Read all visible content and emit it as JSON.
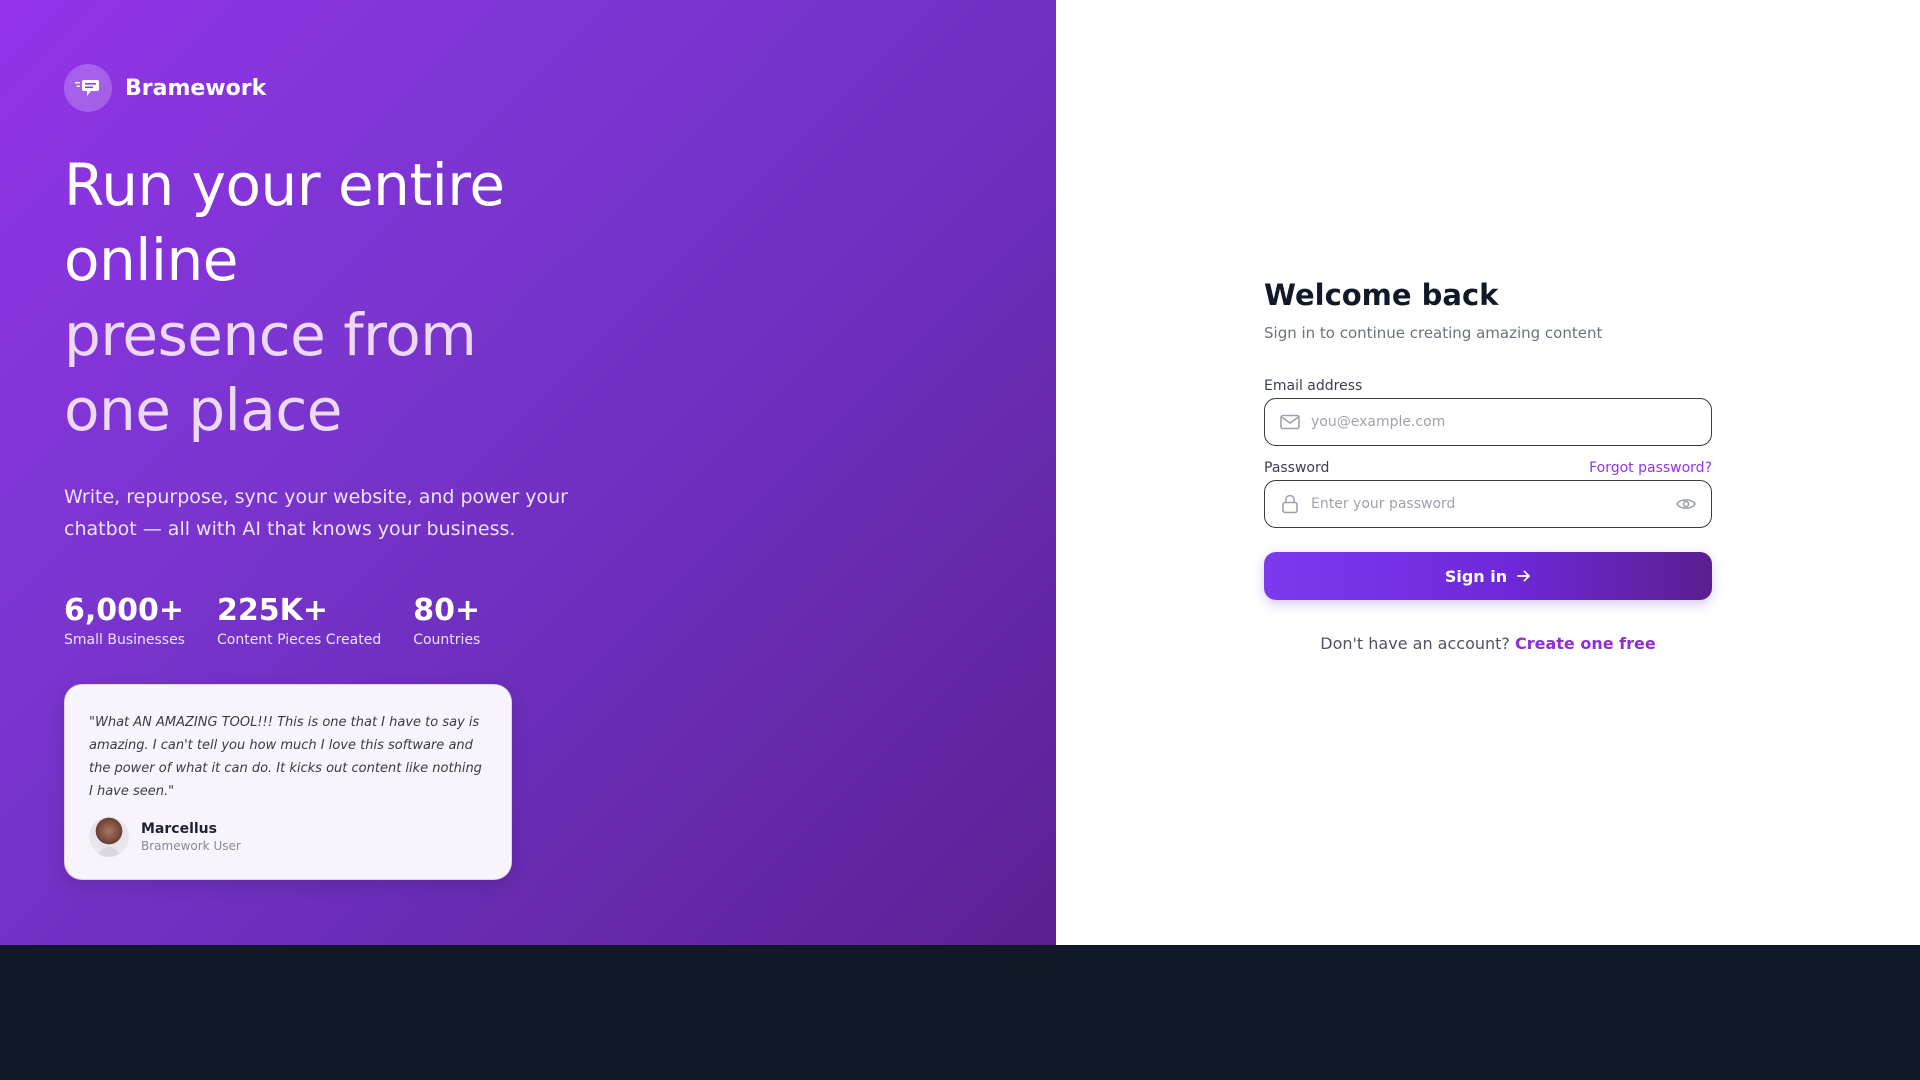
{
  "brand": {
    "name": "Bramework",
    "icon": "chat-bubble-icon"
  },
  "hero": {
    "headline_line1": "Run your entire",
    "headline_line2": "online",
    "headline_line3": "presence from",
    "headline_line4": "one place",
    "subcopy": "Write, repurpose, sync your website, and power your chatbot — all with AI that knows your business."
  },
  "stats": [
    {
      "value": "6,000+",
      "label": "Small Businesses"
    },
    {
      "value": "225K+",
      "label": "Content Pieces Created"
    },
    {
      "value": "80+",
      "label": "Countries"
    }
  ],
  "testimonial": {
    "quote": "\"What AN AMAZING TOOL!!! This is one that I have to say is amazing. I can't tell you how much I love this software and the power of what it can do. It kicks out content like nothing I have seen.\"",
    "author_name": "Marcellus",
    "author_role": "Bramework User"
  },
  "login": {
    "title": "Welcome back",
    "subtitle": "Sign in to continue creating amazing content",
    "email_label": "Email address",
    "email_placeholder": "you@example.com",
    "email_value": "",
    "password_label": "Password",
    "forgot_label": "Forgot password?",
    "password_placeholder": "Enter your password",
    "password_value": "",
    "signin_label": "Sign in",
    "signup_prompt": "Don't have an account?",
    "signup_link": "Create one free"
  },
  "colors": {
    "accent": "#9333ea",
    "gradient_start": "#9333ea",
    "gradient_end": "#5b2190",
    "footer_band": "#111827"
  }
}
